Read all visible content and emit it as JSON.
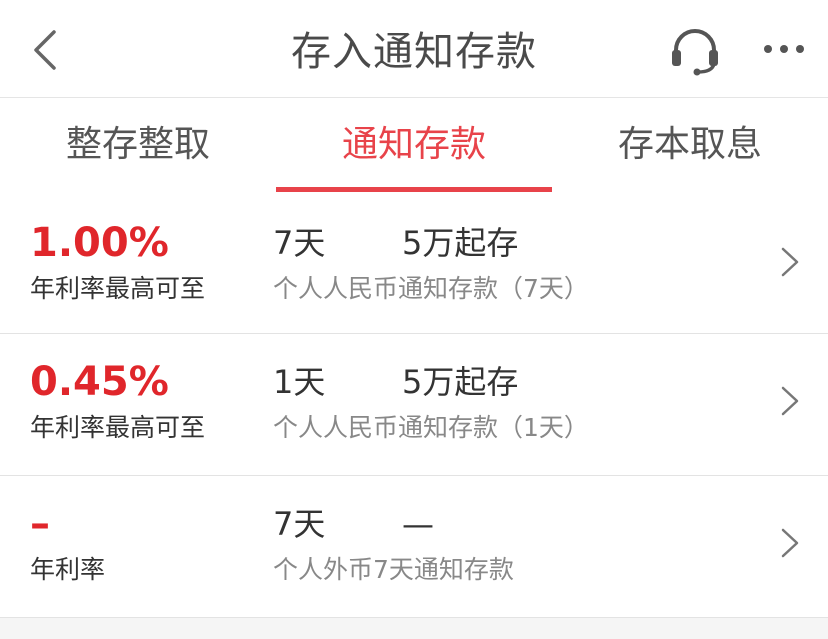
{
  "header": {
    "title": "存入通知存款"
  },
  "tabs": [
    {
      "label": "整存整取",
      "active": false
    },
    {
      "label": "通知存款",
      "active": true
    },
    {
      "label": "存本取息",
      "active": false
    }
  ],
  "products": [
    {
      "rate": "1.00%",
      "rate_label": "年利率最高可至",
      "term": "7天",
      "min_amount": "5万起存",
      "name": "个人人民币通知存款（7天）"
    },
    {
      "rate": "0.45%",
      "rate_label": "年利率最高可至",
      "term": "1天",
      "min_amount": "5万起存",
      "name": "个人人民币通知存款（1天）"
    },
    {
      "rate": "–",
      "rate_label": "年利率",
      "term": "7天",
      "min_amount": "—",
      "name": "个人外币7天通知存款"
    }
  ],
  "colors": {
    "accent": "#e8434a",
    "rate": "#e0262b",
    "title": "#4a4a4a"
  },
  "icons": {
    "back": "back-arrow-icon",
    "support": "headset-icon",
    "more": "more-dots-icon",
    "row_chevron": "chevron-right-icon"
  }
}
